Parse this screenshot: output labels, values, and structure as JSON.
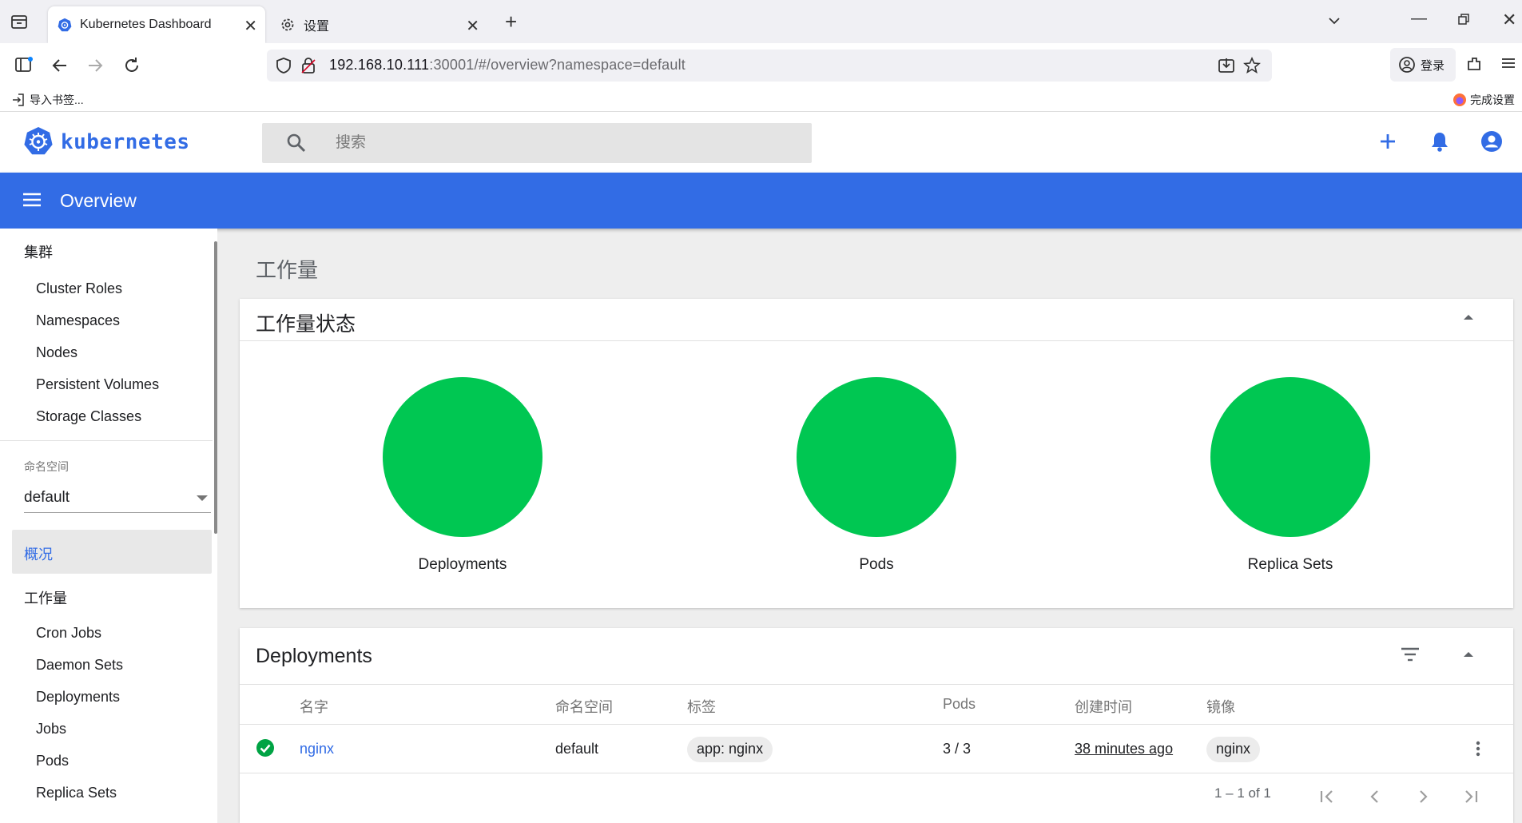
{
  "browser": {
    "tabs": [
      {
        "title": "Kubernetes Dashboard",
        "active": true
      },
      {
        "title": "设置",
        "active": false
      }
    ],
    "url": {
      "host": "192.168.10.111",
      "rest": ":30001/#/overview?namespace=default"
    },
    "account_label": "登录",
    "bookmarks": {
      "import_label": "导入书签...",
      "setup_label": "完成设置"
    }
  },
  "header": {
    "logo_text": "kubernetes",
    "search_placeholder": "搜索"
  },
  "toolbar": {
    "title": "Overview"
  },
  "sidebar": {
    "cluster_header": "集群",
    "cluster_items": [
      "Cluster Roles",
      "Namespaces",
      "Nodes",
      "Persistent Volumes",
      "Storage Classes"
    ],
    "namespace_label": "命名空间",
    "namespace_value": "default",
    "overview_label": "概况",
    "workloads_header": "工作量",
    "workload_items": [
      "Cron Jobs",
      "Daemon Sets",
      "Deployments",
      "Jobs",
      "Pods",
      "Replica Sets"
    ]
  },
  "main": {
    "heading": "工作量",
    "status_card": {
      "title": "工作量状态",
      "charts": [
        {
          "label": "Deployments",
          "running_fraction": 1.0,
          "color": "#00c752"
        },
        {
          "label": "Pods",
          "running_fraction": 1.0,
          "color": "#00c752"
        },
        {
          "label": "Replica Sets",
          "running_fraction": 1.0,
          "color": "#00c752"
        }
      ]
    },
    "deployments_card": {
      "title": "Deployments",
      "columns": [
        "名字",
        "命名空间",
        "标签",
        "Pods",
        "创建时间",
        "镜像"
      ],
      "rows": [
        {
          "name": "nginx",
          "namespace": "default",
          "label": "app: nginx",
          "pods": "3 / 3",
          "created": "38 minutes ago",
          "image": "nginx",
          "status": "ok"
        }
      ],
      "pagination": "1 – 1 of 1"
    }
  },
  "colors": {
    "brand": "#326ce5",
    "success": "#00c752",
    "link": "#326ce5"
  }
}
